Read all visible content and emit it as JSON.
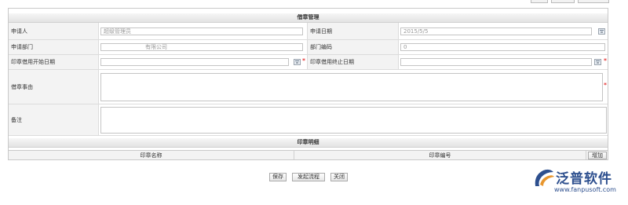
{
  "form": {
    "title": "借章管理",
    "fields": {
      "applicant": {
        "label": "申请人",
        "value": "超级管理员"
      },
      "apply_date": {
        "label": "申请日期",
        "value": "2015/5/5"
      },
      "department": {
        "label": "申请部门",
        "value": "有限公司"
      },
      "dept_code": {
        "label": "部门编码",
        "value": "0"
      },
      "start_date": {
        "label": "印章借用开始日期",
        "value": ""
      },
      "end_date": {
        "label": "印章借用终止日期",
        "value": ""
      },
      "reason": {
        "label": "借章事由",
        "value": ""
      },
      "remark": {
        "label": "备注",
        "value": ""
      }
    },
    "required_mark": "*"
  },
  "detail": {
    "title": "印章明细",
    "columns": [
      "印章名称",
      "印章编号"
    ],
    "add_label": "增加"
  },
  "actions": {
    "save": "保存",
    "submit": "发起流程",
    "close": "关闭"
  },
  "logo": {
    "name": "泛普软件",
    "url": "www.fanpusoft.com",
    "accent_color": "#2d4f8e"
  }
}
